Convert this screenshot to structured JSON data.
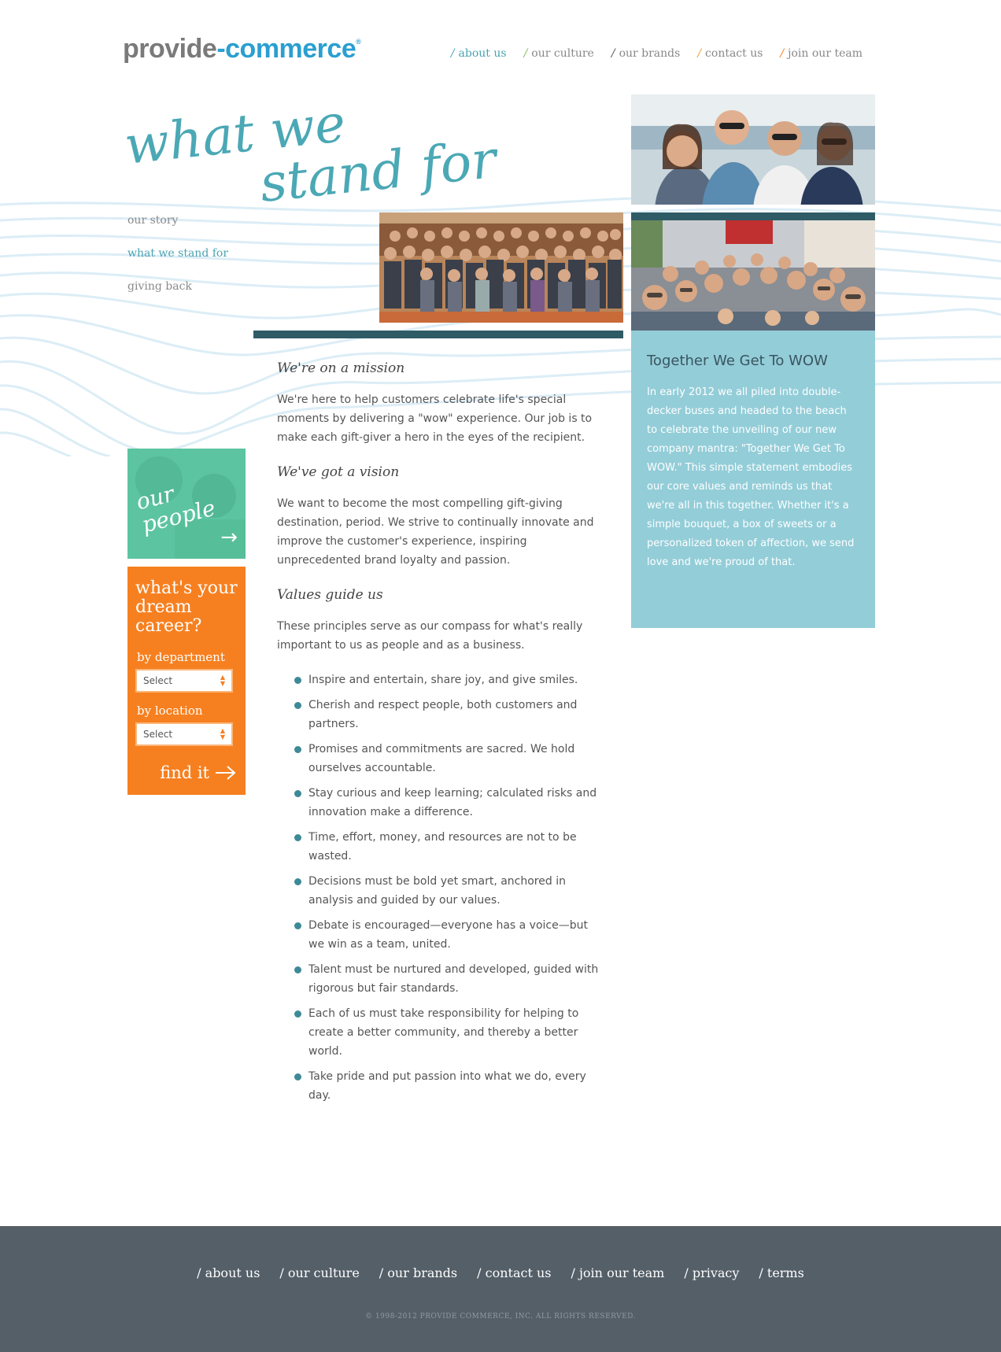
{
  "brand": {
    "part1": "provide",
    "part2": "-commerce",
    "mark": "®"
  },
  "topnav": [
    {
      "label": "about us",
      "slash": "/",
      "color": "#4aa3b2",
      "active": true
    },
    {
      "label": "our culture",
      "slash": "/",
      "color": "#7fbf5a"
    },
    {
      "label": "our brands",
      "slash": "/",
      "color": "#555555"
    },
    {
      "label": "contact us",
      "slash": "/",
      "color": "#e8a33a"
    },
    {
      "label": "join our team",
      "slash": "/",
      "color": "#f68020"
    }
  ],
  "hero": {
    "line1": "what we",
    "line2": "stand for"
  },
  "subnav": [
    {
      "label": "our story"
    },
    {
      "label": "what we stand for",
      "active": true
    },
    {
      "label": "giving back"
    }
  ],
  "promo_people": {
    "line1": "our",
    "line2": "people",
    "arrow": "→"
  },
  "career": {
    "title_line1": "what's your",
    "title_line2": "dream",
    "title_line3": "career?",
    "dept_label": "by department",
    "dept_value": "Select",
    "loc_label": "by location",
    "loc_value": "Select",
    "find_label": "find it"
  },
  "main": {
    "s1_title": "We're on a mission",
    "s1_text": "We're here to help customers celebrate life's special moments by delivering a \"wow\" experience. Our job is to make each gift-giver a hero in the eyes of the recipient.",
    "s2_title": "We've got a vision",
    "s2_text": "We want to become the most compelling gift-giving destination, period. We strive to continually innovate and improve the customer's experience, inspiring unprecedented brand loyalty and passion.",
    "s3_title": "Values guide us",
    "s3_text": "These principles serve as our compass for what's really important to us as people and as a business.",
    "values": [
      "Inspire and entertain, share joy, and give smiles.",
      "Cherish and respect people, both customers and partners.",
      "Promises and commitments are sacred. We hold ourselves accountable.",
      "Stay curious and keep learning; calculated risks and innovation make a difference.",
      "Time, effort, money, and resources are not to be wasted.",
      "Decisions must be bold yet smart, anchored in analysis and guided by our values.",
      "Debate is encouraged—everyone has a voice—but we win as a team, united.",
      "Talent must be nurtured and developed, guided with rigorous but fair standards.",
      "Each of us must take responsibility for helping to create a better community, and thereby a better world.",
      "Take pride and put passion into what we do, every day."
    ]
  },
  "wow": {
    "title": "Together We Get To WOW",
    "text": "In early 2012 we all piled into double-decker buses and headed to the beach to celebrate the unveiling of our new company mantra: \"Together We Get To WOW.\" This simple statement embodies our core values and reminds us that we're all in this together. Whether it's a simple bouquet, a box of sweets or a personalized token of affection, we send love and we're proud of that."
  },
  "footer": {
    "links": [
      "/ about us",
      "/ our culture",
      "/ our brands",
      "/ contact us",
      "/ join our team",
      "/ privacy",
      "/ terms"
    ],
    "copyright": "© 1998-2012 PROVIDE COMMERCE, INC. ALL RIGHTS RESERVED."
  }
}
